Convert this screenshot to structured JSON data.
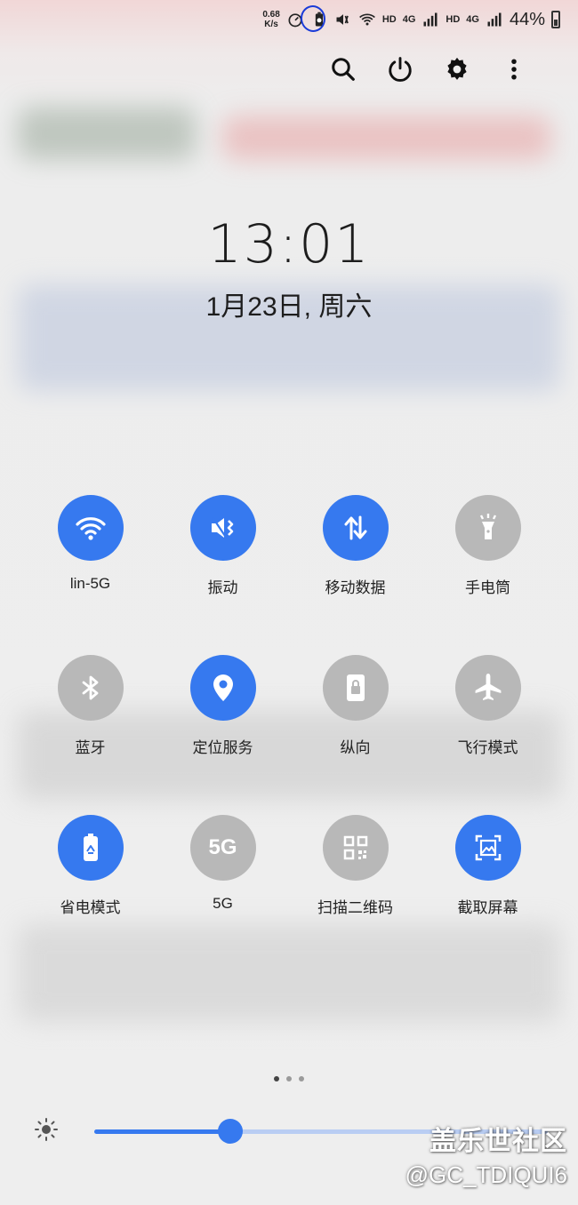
{
  "status_bar": {
    "net_speed_value": "0.68",
    "net_speed_unit": "K/s",
    "hd_label_1": "HD",
    "network_1": "4G",
    "hd_label_2": "HD",
    "network_2": "4G",
    "battery_percent": "44%",
    "battery_level": 0.44
  },
  "toolbar": {
    "icons": [
      "search-icon",
      "power-icon",
      "gear-icon",
      "more-vertical-icon"
    ]
  },
  "clock": {
    "time": "13:01",
    "date": "1月23日, 周六"
  },
  "tiles": [
    {
      "label": "lin-5G",
      "icon": "wifi-icon",
      "on": true
    },
    {
      "label": "振动",
      "icon": "vibrate-icon",
      "on": true
    },
    {
      "label": "移动数据",
      "icon": "mobile-data-icon",
      "on": true
    },
    {
      "label": "手电筒",
      "icon": "flashlight-icon",
      "on": false
    },
    {
      "label": "蓝牙",
      "icon": "bluetooth-icon",
      "on": false
    },
    {
      "label": "定位服务",
      "icon": "location-icon",
      "on": true
    },
    {
      "label": "纵向",
      "icon": "portrait-lock-icon",
      "on": false
    },
    {
      "label": "飞行模式",
      "icon": "airplane-icon",
      "on": false
    },
    {
      "label": "省电模式",
      "icon": "power-saving-icon",
      "on": true
    },
    {
      "label": "5G",
      "icon": "5g-icon",
      "icon_text": "5G",
      "on": false
    },
    {
      "label": "扫描二维码",
      "icon": "qr-code-icon",
      "on": false
    },
    {
      "label": "截取屏幕",
      "icon": "screenshot-icon",
      "on": true
    }
  ],
  "pager": {
    "pages": 3,
    "current": 1
  },
  "brightness": {
    "icon": "sun-icon",
    "level": 0.3
  },
  "watermark": {
    "title": "盖乐世社区",
    "user": "@GC_TDIQUI6"
  },
  "colors": {
    "accent": "#3679ef",
    "tile_off": "#b8b8b8",
    "text": "#222222"
  }
}
